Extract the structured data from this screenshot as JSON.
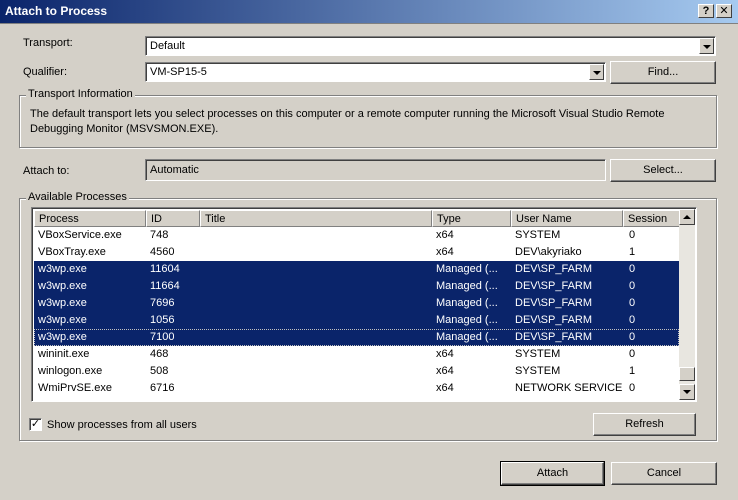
{
  "window": {
    "title": "Attach to Process",
    "help_label": "?",
    "close_label": "✕"
  },
  "transport": {
    "label": "Transport:",
    "value": "Default"
  },
  "qualifier": {
    "label": "Qualifier:",
    "value": "VM-SP15-5",
    "find_label": "Find..."
  },
  "transport_info": {
    "title": "Transport Information",
    "text": "The default transport lets you select processes on this computer or a remote computer running the Microsoft Visual Studio Remote Debugging Monitor (MSVSMON.EXE)."
  },
  "attach_to": {
    "label": "Attach to:",
    "value": "Automatic",
    "select_label": "Select..."
  },
  "processes": {
    "title": "Available Processes",
    "columns": [
      "Process",
      "ID",
      "Title",
      "Type",
      "User Name",
      "Session"
    ],
    "rows": [
      {
        "process": "VBoxService.exe",
        "id": "748",
        "title": "",
        "type": "x64",
        "user": "SYSTEM",
        "session": "0"
      },
      {
        "process": "VBoxTray.exe",
        "id": "4560",
        "title": "",
        "type": "x64",
        "user": "DEV\\akyriako",
        "session": "1"
      },
      {
        "process": "w3wp.exe",
        "id": "11604",
        "title": "",
        "type": "Managed (...",
        "user": "DEV\\SP_FARM",
        "session": "0"
      },
      {
        "process": "w3wp.exe",
        "id": "11664",
        "title": "",
        "type": "Managed (...",
        "user": "DEV\\SP_FARM",
        "session": "0"
      },
      {
        "process": "w3wp.exe",
        "id": "7696",
        "title": "",
        "type": "Managed (...",
        "user": "DEV\\SP_FARM",
        "session": "0"
      },
      {
        "process": "w3wp.exe",
        "id": "1056",
        "title": "",
        "type": "Managed (...",
        "user": "DEV\\SP_FARM",
        "session": "0"
      },
      {
        "process": "w3wp.exe",
        "id": "7100",
        "title": "",
        "type": "Managed (...",
        "user": "DEV\\SP_FARM",
        "session": "0"
      },
      {
        "process": "wininit.exe",
        "id": "468",
        "title": "",
        "type": "x64",
        "user": "SYSTEM",
        "session": "0"
      },
      {
        "process": "winlogon.exe",
        "id": "508",
        "title": "",
        "type": "x64",
        "user": "SYSTEM",
        "session": "1"
      },
      {
        "process": "WmiPrvSE.exe",
        "id": "6716",
        "title": "",
        "type": "x64",
        "user": "NETWORK SERVICE",
        "session": "0"
      }
    ],
    "show_all_label": "Show processes from all users",
    "show_all_checked": true,
    "refresh_label": "Refresh"
  },
  "footer": {
    "attach_label": "Attach",
    "cancel_label": "Cancel"
  }
}
